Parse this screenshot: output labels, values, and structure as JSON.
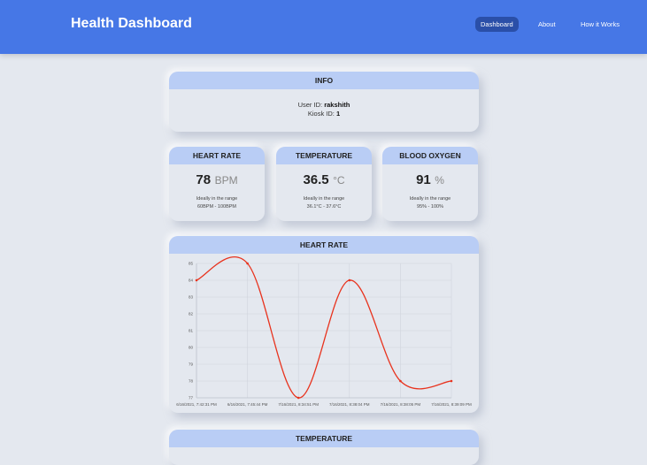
{
  "app": {
    "title": "Health Dashboard"
  },
  "nav": {
    "items": [
      {
        "label": "Dashboard",
        "active": true
      },
      {
        "label": "About",
        "active": false
      },
      {
        "label": "How it Works",
        "active": false
      }
    ]
  },
  "info": {
    "title": "INFO",
    "user_id_label": "User ID:",
    "user_id": "rakshith",
    "kiosk_id_label": "Kiosk ID:",
    "kiosk_id": "1"
  },
  "metrics": {
    "heart_rate": {
      "title": "HEART RATE",
      "value": "78",
      "unit": "BPM",
      "range_label": "Ideally in the range",
      "range": "60BPM - 100BPM"
    },
    "temperature": {
      "title": "TEMPERATURE",
      "value": "36.5",
      "unit": "°C",
      "range_label": "Ideally in the range",
      "range": "36.1°C - 37.6°C"
    },
    "blood_oxygen": {
      "title": "BLOOD OXYGEN",
      "value": "91",
      "unit": "%",
      "range_label": "Ideally in the range",
      "range": "95% - 100%"
    }
  },
  "heart_chart": {
    "title": "HEART RATE"
  },
  "temperature_chart": {
    "title": "TEMPERATURE"
  },
  "colors": {
    "nav": "#4677e6",
    "header": "#b9cdf5",
    "line": "#e8331e",
    "background": "#e4e8ef"
  },
  "chart_data": {
    "type": "line",
    "title": "HEART RATE",
    "categories": [
      "6/16/2021, 7:42:31 PM",
      "6/16/2021, 7:45:44 PM",
      "7/16/2021, 8:34:51 PM",
      "7/16/2021, 8:38:04 PM",
      "7/16/2021, 8:38:05 PM",
      "7/16/2021, 8:39:09 PM"
    ],
    "series": [
      {
        "values": [
          84,
          85,
          77,
          84,
          78,
          78
        ]
      }
    ],
    "y_ticks": [
      77,
      78,
      79,
      80,
      81,
      82,
      83,
      84,
      85
    ],
    "ylim": [
      77,
      85
    ],
    "grid": true
  }
}
